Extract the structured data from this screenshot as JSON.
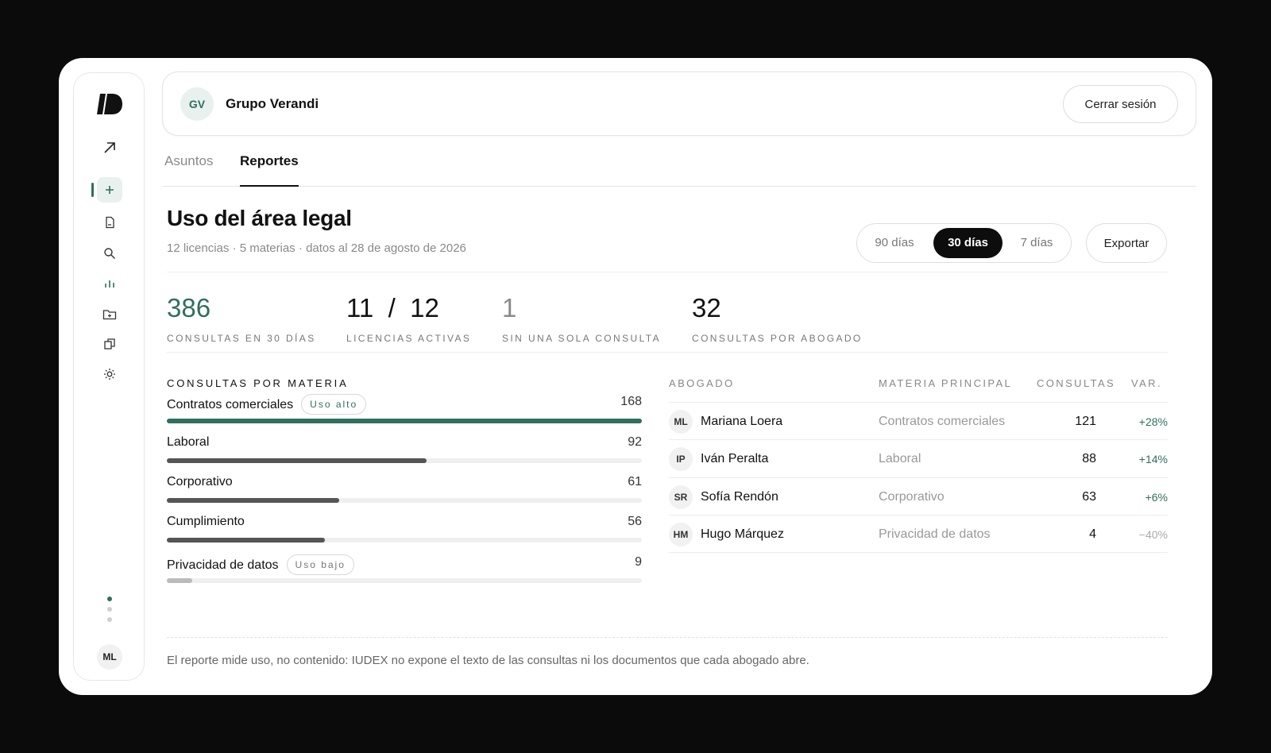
{
  "org": {
    "initials": "GV",
    "name": "Grupo Verandi",
    "logout_label": "Cerrar sesión"
  },
  "rail": {
    "user_initials": "ML"
  },
  "tabs": [
    {
      "label": "Asuntos"
    },
    {
      "label": "Reportes"
    }
  ],
  "page": {
    "title": "Uso del área legal",
    "subtitle": "12 licencias · 5 materias · datos al 28 de agosto de 2026"
  },
  "range": {
    "options": [
      "90 días",
      "30 días",
      "7 días"
    ],
    "selected": "30 días"
  },
  "export_label": "Exportar",
  "kpis": [
    {
      "value": "386",
      "label": "Consultas en 30 días",
      "color": "#2f6f5f"
    },
    {
      "value": "11  /  12",
      "label": "Licencias activas",
      "color": "#111111"
    },
    {
      "value": "1",
      "label": "Sin una sola consulta",
      "color": "#8a8a8a"
    },
    {
      "value": "32",
      "label": "Consultas por abogado",
      "color": "#111111"
    }
  ],
  "subjects": {
    "title": "Consultas por materia",
    "max": 168,
    "items": [
      {
        "name": "Contratos comerciales",
        "count": 168,
        "badge": "Uso alto",
        "color": "#2f6f5f"
      },
      {
        "name": "Laboral",
        "count": 92,
        "badge": "",
        "color": "#555555"
      },
      {
        "name": "Corporativo",
        "count": 61,
        "badge": "",
        "color": "#555555"
      },
      {
        "name": "Cumplimiento",
        "count": 56,
        "badge": "",
        "color": "#555555"
      },
      {
        "name": "Privacidad de datos",
        "count": 9,
        "badge": "Uso bajo",
        "color": "#bbbbbb"
      }
    ]
  },
  "lawyers": {
    "headers": {
      "name": "Abogado",
      "subject": "Materia principal",
      "count": "Consultas",
      "var": "Var."
    },
    "rows": [
      {
        "initials": "ML",
        "name": "Mariana Loera",
        "subject": "Contratos comerciales",
        "count": "121",
        "var": "+28%",
        "positive": true
      },
      {
        "initials": "IP",
        "name": "Iván Peralta",
        "subject": "Laboral",
        "count": "88",
        "var": "+14%",
        "positive": true
      },
      {
        "initials": "SR",
        "name": "Sofía Rendón",
        "subject": "Corporativo",
        "count": "63",
        "var": "+6%",
        "positive": true
      },
      {
        "initials": "HM",
        "name": "Hugo Márquez",
        "subject": "Privacidad de datos",
        "count": "4",
        "var": "−40%",
        "positive": false
      }
    ]
  },
  "footnote": "El reporte mide uso, no contenido: IUDEX no expone el texto de las consultas ni los documentos que cada abogado abre."
}
